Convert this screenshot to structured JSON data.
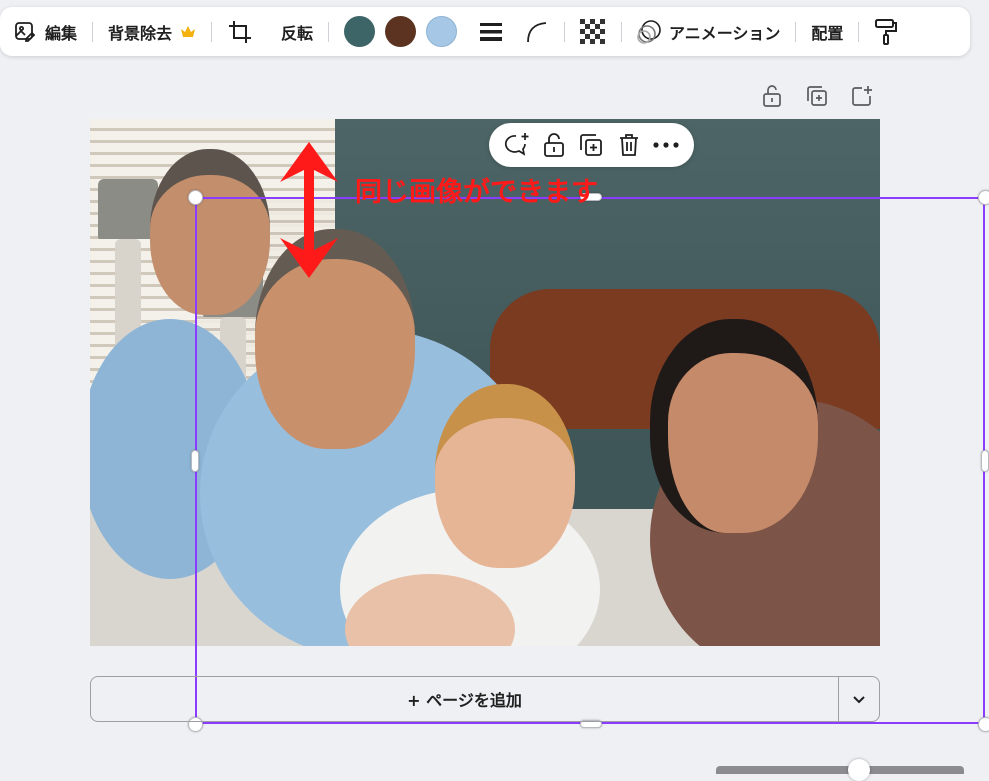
{
  "toolbar": {
    "edit_label": "編集",
    "remove_bg_label": "背景除去",
    "flip_label": "反転",
    "animation_label": "アニメーション",
    "position_label": "配置",
    "colors": [
      "#3d6467",
      "#5b3320",
      "#a6c8e6"
    ],
    "icons": [
      "image-edit-icon",
      "crown-icon",
      "crop-icon",
      "border-style-icon",
      "corner-rounding-icon",
      "transparency-icon",
      "animation-icon",
      "paint-roller-icon"
    ]
  },
  "page_actions": {
    "icons": [
      "unlock-icon",
      "duplicate-page-icon",
      "add-page-icon"
    ]
  },
  "float_toolbar": {
    "icons": [
      "add-comment-icon",
      "unlock-icon",
      "duplicate-icon",
      "trash-icon",
      "more-icon"
    ]
  },
  "annotation": {
    "text": "同じ画像ができます",
    "color": "#ff1a1a"
  },
  "add_page": {
    "label": "+ ページを追加"
  },
  "selection": {
    "color": "#8b3dff"
  }
}
